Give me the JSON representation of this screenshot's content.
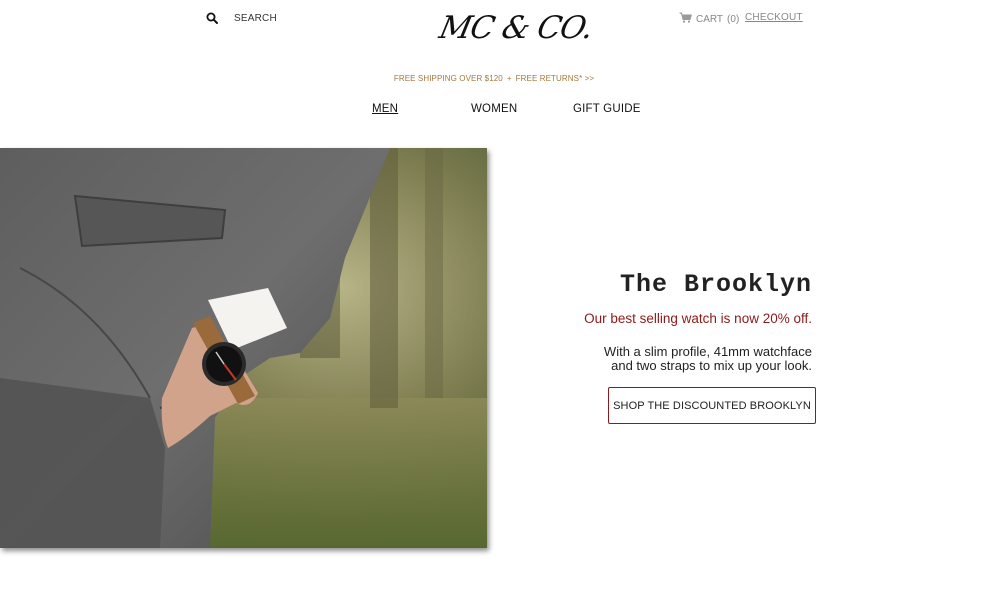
{
  "header": {
    "search_label": "SEARCH",
    "logo_text": "MC & CO.",
    "cart_label": "CART",
    "cart_count": "(0)",
    "checkout_label": "CHECKOUT",
    "search_icon": "search-icon",
    "cart_icon": "cart-icon"
  },
  "promo": {
    "shipping": "FREE SHIPPING OVER $120",
    "separator": "+",
    "returns": "FREE RETURNS* >>"
  },
  "nav": {
    "items": [
      {
        "label": "MEN",
        "active": true
      },
      {
        "label": "WOMEN",
        "active": false
      },
      {
        "label": "GIFT GUIDE",
        "active": false
      }
    ]
  },
  "hero": {
    "title": "The Brooklyn",
    "discount_text": "Our best selling watch is now 20% off.",
    "description_line1": "With a slim profile, 41mm watchface",
    "description_line2": "and two straps to mix up your look.",
    "cta_label": "SHOP THE DISCOUNTED BROOKLYN"
  },
  "colors": {
    "accent_red": "#8b1a1a",
    "promo_gold": "#a07a3c",
    "muted_gray": "#888888"
  }
}
